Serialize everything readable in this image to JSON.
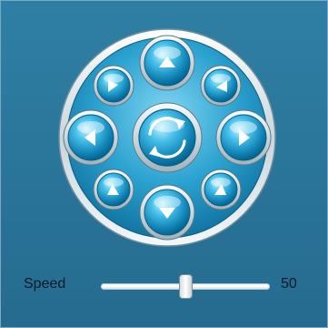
{
  "speed": {
    "label": "Speed",
    "value": "50",
    "level_percent": 50
  },
  "controls": [
    {
      "name": "pan-up-button",
      "icon": "arrow-up-icon"
    },
    {
      "name": "pan-down-button",
      "icon": "arrow-down-icon"
    },
    {
      "name": "pan-left-button",
      "icon": "arrow-left-icon"
    },
    {
      "name": "pan-right-button",
      "icon": "arrow-right-icon"
    },
    {
      "name": "pan-up-left-button",
      "icon": "arrow-up-left-icon"
    },
    {
      "name": "pan-up-right-button",
      "icon": "arrow-up-right-icon"
    },
    {
      "name": "pan-down-left-button",
      "icon": "arrow-down-left-icon"
    },
    {
      "name": "pan-down-right-button",
      "icon": "arrow-down-right-icon"
    },
    {
      "name": "auto-rotate-button",
      "icon": "rotate-icon"
    }
  ],
  "colors": {
    "background": "#2a7499",
    "button": "#1e95c4",
    "ring": "#d8e2e6"
  }
}
